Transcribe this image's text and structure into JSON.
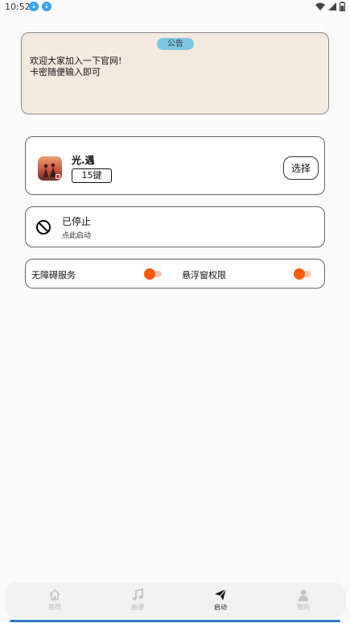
{
  "status_bar": {
    "time": "10:52",
    "icons": [
      "download-icon",
      "download-icon",
      "wifi-icon",
      "signal-icon",
      "battery-icon"
    ]
  },
  "notice": {
    "tag": "公告",
    "lines": [
      "欢迎大家加入一下官网!",
      "卡密随便输入即可"
    ]
  },
  "game": {
    "name": "光.遇",
    "keys": "15键",
    "select_label": "选择"
  },
  "service": {
    "title": "已停止",
    "subtitle": "点此启动"
  },
  "permissions": {
    "accessibility_label": "无障碍服务",
    "overlay_label": "悬浮窗权限",
    "accent_color": "#fb5d0f"
  },
  "nav": {
    "items": [
      {
        "label": "首页",
        "icon": "home-icon"
      },
      {
        "label": "曲谱",
        "icon": "music-note-icon"
      },
      {
        "label": "启动",
        "icon": "send-icon",
        "active": true
      },
      {
        "label": "我的",
        "icon": "person-icon"
      }
    ]
  }
}
